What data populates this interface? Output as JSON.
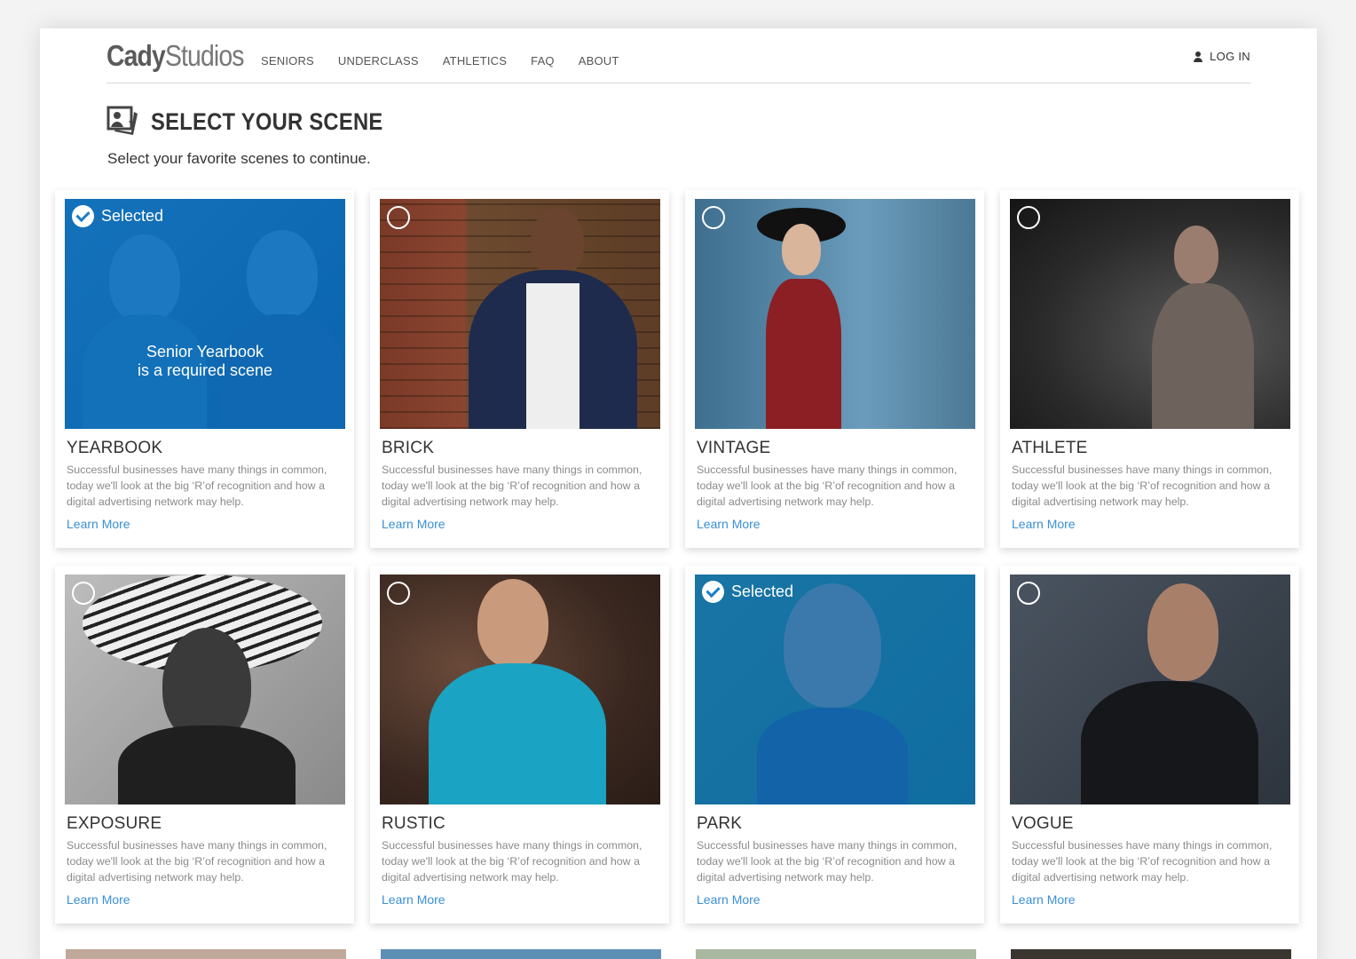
{
  "brand": {
    "name_bold": "Cady",
    "name_light": "Studios"
  },
  "nav": [
    {
      "label": "SENIORS"
    },
    {
      "label": "UNDERCLASS"
    },
    {
      "label": "ATHLETICS"
    },
    {
      "label": "FAQ"
    },
    {
      "label": "ABOUT"
    }
  ],
  "login": {
    "label": "LOG IN",
    "icon": "user-icon"
  },
  "page": {
    "title": "SELECT YOUR SCENE",
    "title_icon": "photos-icon",
    "subtitle": "Select your favorite scenes to continue."
  },
  "selection": {
    "selected_label": "Selected",
    "required_line1": "Senior Yearbook",
    "required_line2": "is a required scene"
  },
  "colors": {
    "accent": "#3a8fd6",
    "selected_overlay": "#0a73c8"
  },
  "scenes": [
    {
      "title": "YEARBOOK",
      "selected": true,
      "required": true,
      "desc": "Successful businesses have many things in common, today we'll look at the big ‘R’of recognition and how a digital advertising network may help.",
      "link": "Learn More"
    },
    {
      "title": "BRICK",
      "selected": false,
      "desc": "Successful businesses have many things in common, today we'll look at the big ‘R’of recognition and how a digital advertising network may help.",
      "link": "Learn More"
    },
    {
      "title": "VINTAGE",
      "selected": false,
      "desc": "Successful businesses have many things in common, today we'll look at the big ‘R’of recognition and how a digital advertising network may help.",
      "link": "Learn More"
    },
    {
      "title": "ATHLETE",
      "selected": false,
      "desc": "Successful businesses have many things in common, today we'll look at the big ‘R’of recognition and how a digital advertising network may help.",
      "link": "Learn More"
    },
    {
      "title": "EXPOSURE",
      "selected": false,
      "desc": "Successful businesses have many things in common, today we'll look at the big ‘R’of recognition and how a digital advertising network may help.",
      "link": "Learn More"
    },
    {
      "title": "RUSTIC",
      "selected": false,
      "desc": "Successful businesses have many things in common, today we'll look at the big ‘R’of recognition and how a digital advertising network may help.",
      "link": "Learn More"
    },
    {
      "title": "PARK",
      "selected": true,
      "desc": "Successful businesses have many things in common, today we'll look at the big ‘R’of recognition and how a digital advertising network may help.",
      "link": "Learn More"
    },
    {
      "title": "VOGUE",
      "selected": false,
      "desc": "Successful businesses have many things in common, today we'll look at the big ‘R’of recognition and how a digital advertising network may help.",
      "link": "Learn More"
    }
  ]
}
